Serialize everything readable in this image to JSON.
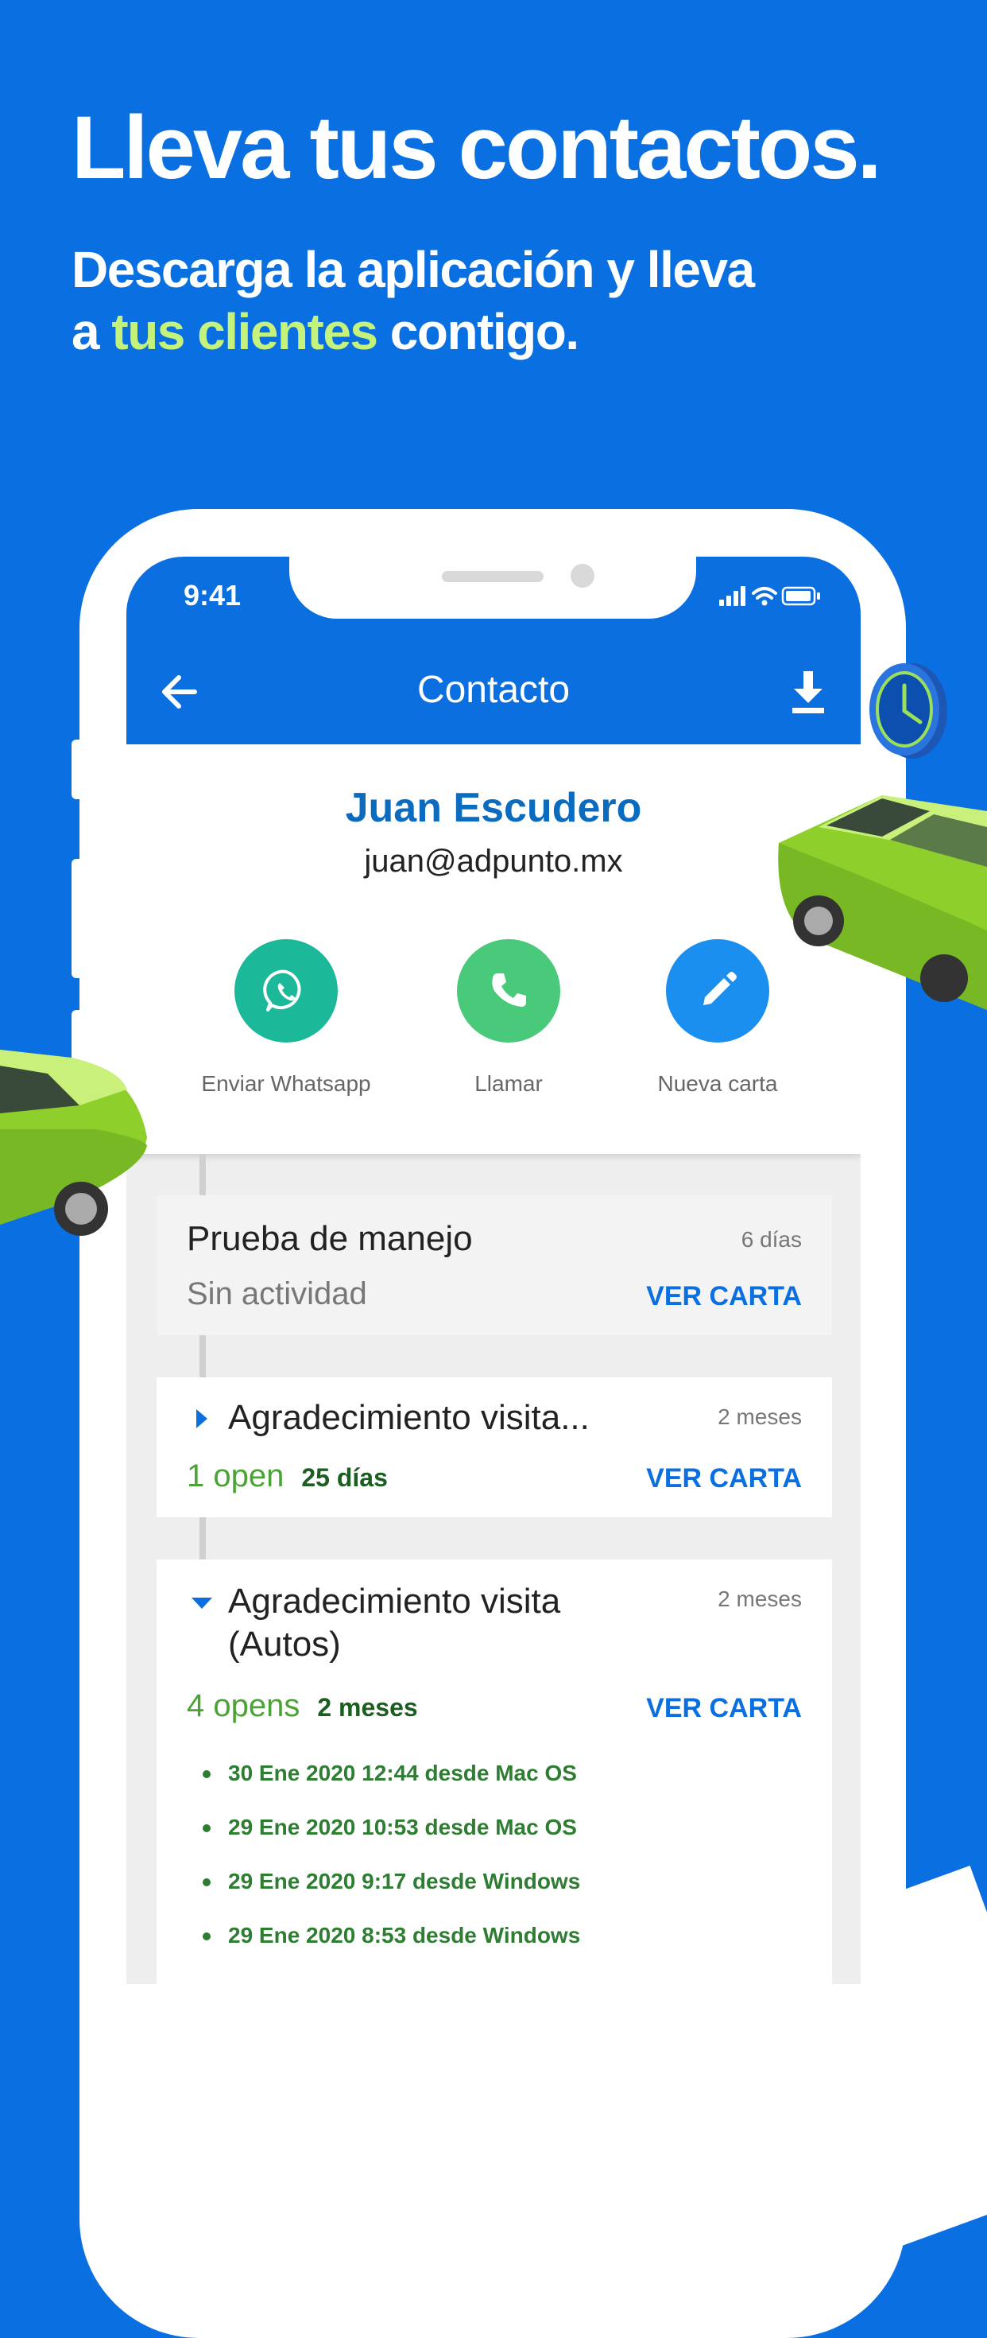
{
  "hero": {
    "headline": "Lleva tus contactos.",
    "sub_line1": "Descarga la aplicación y lleva",
    "sub_prefix": "a ",
    "sub_highlight": "tus clientes",
    "sub_suffix": " contigo."
  },
  "status_bar": {
    "time": "9:41"
  },
  "appbar": {
    "title": "Contacto",
    "icons": [
      "back-arrow-icon",
      "download-icon"
    ]
  },
  "contact": {
    "name": "Juan Escudero",
    "email": "juan@adpunto.mx"
  },
  "actions": [
    {
      "label": "Enviar Whatsapp",
      "icon": "whatsapp-icon",
      "color": "#1bb89a"
    },
    {
      "label": "Llamar",
      "icon": "phone-icon",
      "color": "#49c97a"
    },
    {
      "label": "Nueva carta",
      "icon": "pencil-icon",
      "color": "#1a8ff0"
    }
  ],
  "timeline": [
    {
      "title": "Prueba de manejo",
      "ago": "6 días",
      "status": "Sin actividad",
      "action": "VER CARTA"
    },
    {
      "title": "Agradecimiento visita...",
      "ago": "2 meses",
      "opens": "1 open",
      "duration": "25 días",
      "action": "VER CARTA",
      "expanded": false
    },
    {
      "title_line1": "Agradecimiento visita",
      "title_line2": "(Autos)",
      "ago": "2 meses",
      "opens": "4 opens",
      "duration": "2 meses",
      "action": "VER CARTA",
      "expanded": true,
      "open_events": [
        "30 Ene 2020 12:44 desde Mac OS",
        "29 Ene 2020 10:53 desde Mac OS",
        "29 Ene 2020 9:17 desde Windows",
        "29 Ene 2020 8:53 desde Windows"
      ]
    }
  ],
  "colors": {
    "background": "#0a6fe0",
    "highlight": "#c4f27a",
    "name": "#0b6bbf",
    "link": "#0b6fe0",
    "opens": "#49a335"
  }
}
